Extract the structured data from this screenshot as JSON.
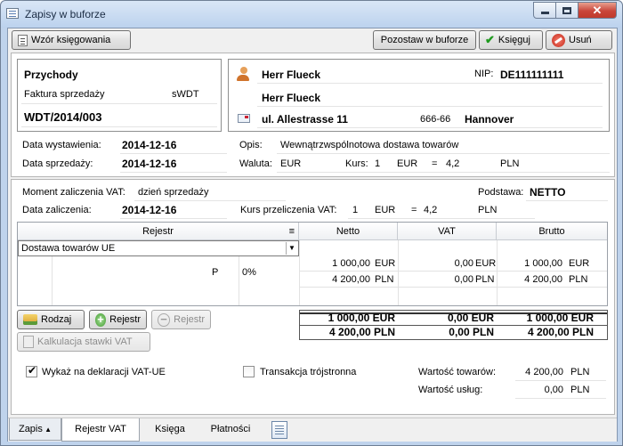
{
  "window": {
    "title": "Zapisy w buforze"
  },
  "toolbar": {
    "wzor": "Wzór księgowania",
    "pozostaw": "Pozostaw w buforze",
    "ksieguj": "Księguj",
    "usun": "Usuń"
  },
  "document": {
    "kind": "Przychody",
    "type": "Faktura sprzedaży",
    "code": "sWDT",
    "number": "WDT/2014/003"
  },
  "contractor": {
    "name1": "Herr Flueck",
    "name2": "Herr Flueck",
    "nip_label": "NIP:",
    "nip": "DE111111111",
    "street": "ul. Allestrasse 11",
    "postcode": "666-66",
    "city": "Hannover"
  },
  "dates": {
    "wystawienia_label": "Data wystawienia:",
    "wystawienia": "2014-12-16",
    "sprzedazy_label": "Data sprzedaży:",
    "sprzedazy": "2014-12-16"
  },
  "desc": {
    "opis_label": "Opis:",
    "opis": "Wewnątrzwspólnotowa dostawa towarów",
    "waluta_label": "Waluta:",
    "waluta": "EUR",
    "kurs_label": "Kurs:",
    "kurs_qty": "1",
    "kurs_cur": "EUR",
    "eq": "=",
    "kurs_val": "4,2",
    "kurs_pln": "PLN"
  },
  "vat": {
    "moment_label": "Moment zaliczenia VAT:",
    "moment": "dzień sprzedaży",
    "podstawa_label": "Podstawa:",
    "podstawa": "NETTO",
    "zaliczenia_label": "Data zaliczenia:",
    "zaliczenia": "2014-12-16",
    "kurs_label": "Kurs przeliczenia VAT:",
    "kurs_qty": "1",
    "kurs_cur": "EUR",
    "eq": "=",
    "kurs_val": "4,2",
    "kurs_pln": "PLN"
  },
  "grid": {
    "headers": {
      "rejestr": "Rejestr",
      "netto": "Netto",
      "vat": "VAT",
      "brutto": "Brutto"
    },
    "register": "Dostawa towarów UE",
    "rate_code": "P",
    "rate": "0%",
    "rows": [
      {
        "netto": "1 000,00",
        "netto_cur": "EUR",
        "vat": "0,00",
        "vat_cur": "EUR",
        "brutto": "1 000,00",
        "brutto_cur": "EUR"
      },
      {
        "netto": "4 200,00",
        "netto_cur": "PLN",
        "vat": "0,00",
        "vat_cur": "PLN",
        "brutto": "4 200,00",
        "brutto_cur": "PLN"
      }
    ]
  },
  "actions": {
    "rodzaj": "Rodzaj",
    "rejestr_add": "Rejestr",
    "rejestr_remove": "Rejestr",
    "kalkulacja": "Kalkulacja stawki VAT"
  },
  "totals": [
    {
      "netto": "1 000,00 EUR",
      "vat": "0,00 EUR",
      "brutto": "1 000,00 EUR"
    },
    {
      "netto": "4 200,00 PLN",
      "vat": "0,00 PLN",
      "brutto": "4 200,00 PLN"
    }
  ],
  "footer": {
    "wykaz": "Wykaż na deklaracji VAT-UE",
    "wykaz_checked": true,
    "trojstronna": "Transakcja trójstronna",
    "towary_label": "Wartość towarów:",
    "towary": "4 200,00",
    "towary_cur": "PLN",
    "uslugi_label": "Wartość usług:",
    "uslugi": "0,00",
    "uslugi_cur": "PLN"
  },
  "tabs": [
    "Zapis",
    "Rejestr VAT",
    "Księga",
    "Płatności"
  ]
}
